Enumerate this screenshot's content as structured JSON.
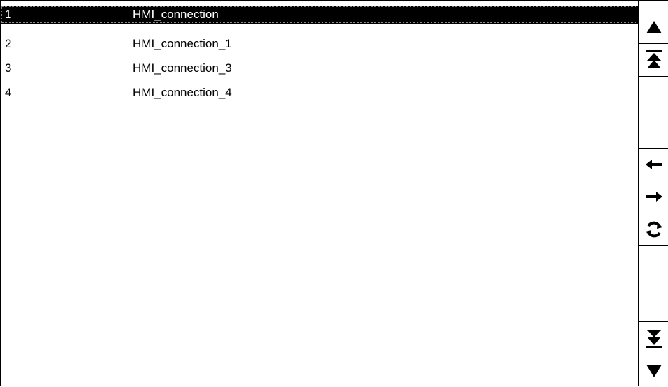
{
  "list": {
    "rows": [
      {
        "id": "1",
        "name": "HMI_connection",
        "selected": true
      },
      {
        "id": "2",
        "name": "HMI_connection_1",
        "selected": false
      },
      {
        "id": "3",
        "name": "HMI_connection_3",
        "selected": false
      },
      {
        "id": "4",
        "name": "HMI_connection_4",
        "selected": false
      }
    ]
  },
  "scrollbar": {
    "buttons": [
      {
        "name": "scroll-up-button",
        "icon": "arrow-up-icon"
      },
      {
        "name": "scroll-top-button",
        "icon": "double-arrow-up-icon"
      },
      {
        "name": "previous-button",
        "icon": "arrow-left-icon"
      },
      {
        "name": "next-button",
        "icon": "arrow-right-icon"
      },
      {
        "name": "refresh-button",
        "icon": "refresh-icon"
      },
      {
        "name": "scroll-bottom-button",
        "icon": "double-arrow-down-icon"
      },
      {
        "name": "scroll-down-button",
        "icon": "arrow-down-icon"
      }
    ]
  },
  "colors": {
    "selected_bg": "#000000",
    "selected_fg": "#ffffff",
    "border": "#000000"
  }
}
